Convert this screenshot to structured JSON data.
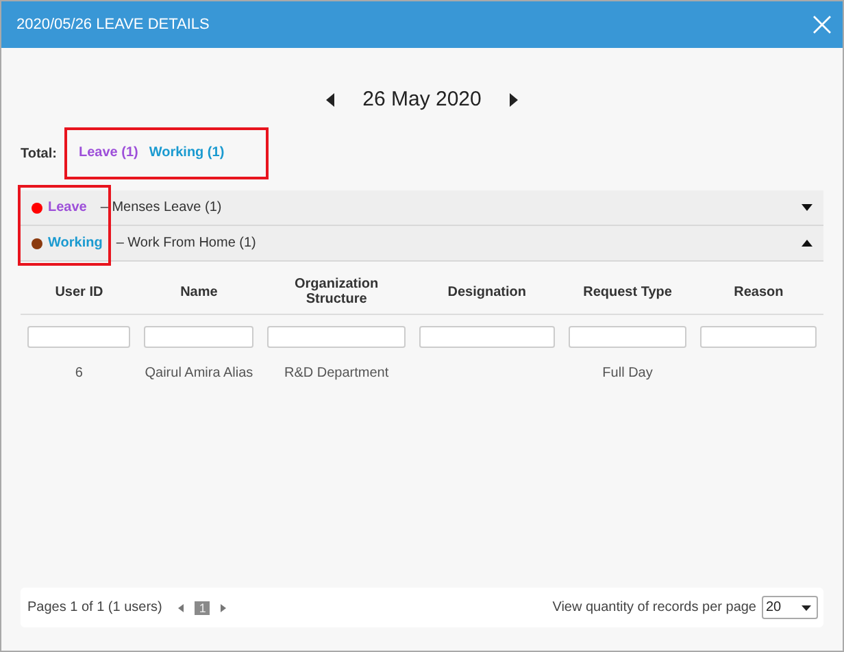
{
  "window": {
    "title": "2020/05/26 LEAVE DETAILS"
  },
  "date_nav": {
    "date": "26 May 2020"
  },
  "totals": {
    "label": "Total:",
    "items": [
      {
        "kind": "leave",
        "text": "Leave (1)"
      },
      {
        "kind": "working",
        "text": "Working (1)"
      }
    ]
  },
  "groups": [
    {
      "kind": "leave",
      "color": "#ff0000",
      "label": "Leave",
      "detail": "– Menses Leave (1)",
      "expanded": false
    },
    {
      "kind": "working",
      "color": "#8b3a0e",
      "label": "Working",
      "detail": "– Work From Home (1)",
      "expanded": true
    }
  ],
  "table": {
    "columns": [
      "User ID",
      "Name",
      "Organization Structure",
      "Designation",
      "Request Type",
      "Reason"
    ],
    "rows": [
      [
        "6",
        "Qairul Amira Alias",
        "R&D Department",
        "",
        "Full Day",
        ""
      ]
    ]
  },
  "pager": {
    "summary": "Pages 1 of 1 (1 users)",
    "pages": [
      {
        "label": "1",
        "selected": true
      }
    ],
    "per_page_label": "View quantity of records per page",
    "per_page": "20"
  }
}
